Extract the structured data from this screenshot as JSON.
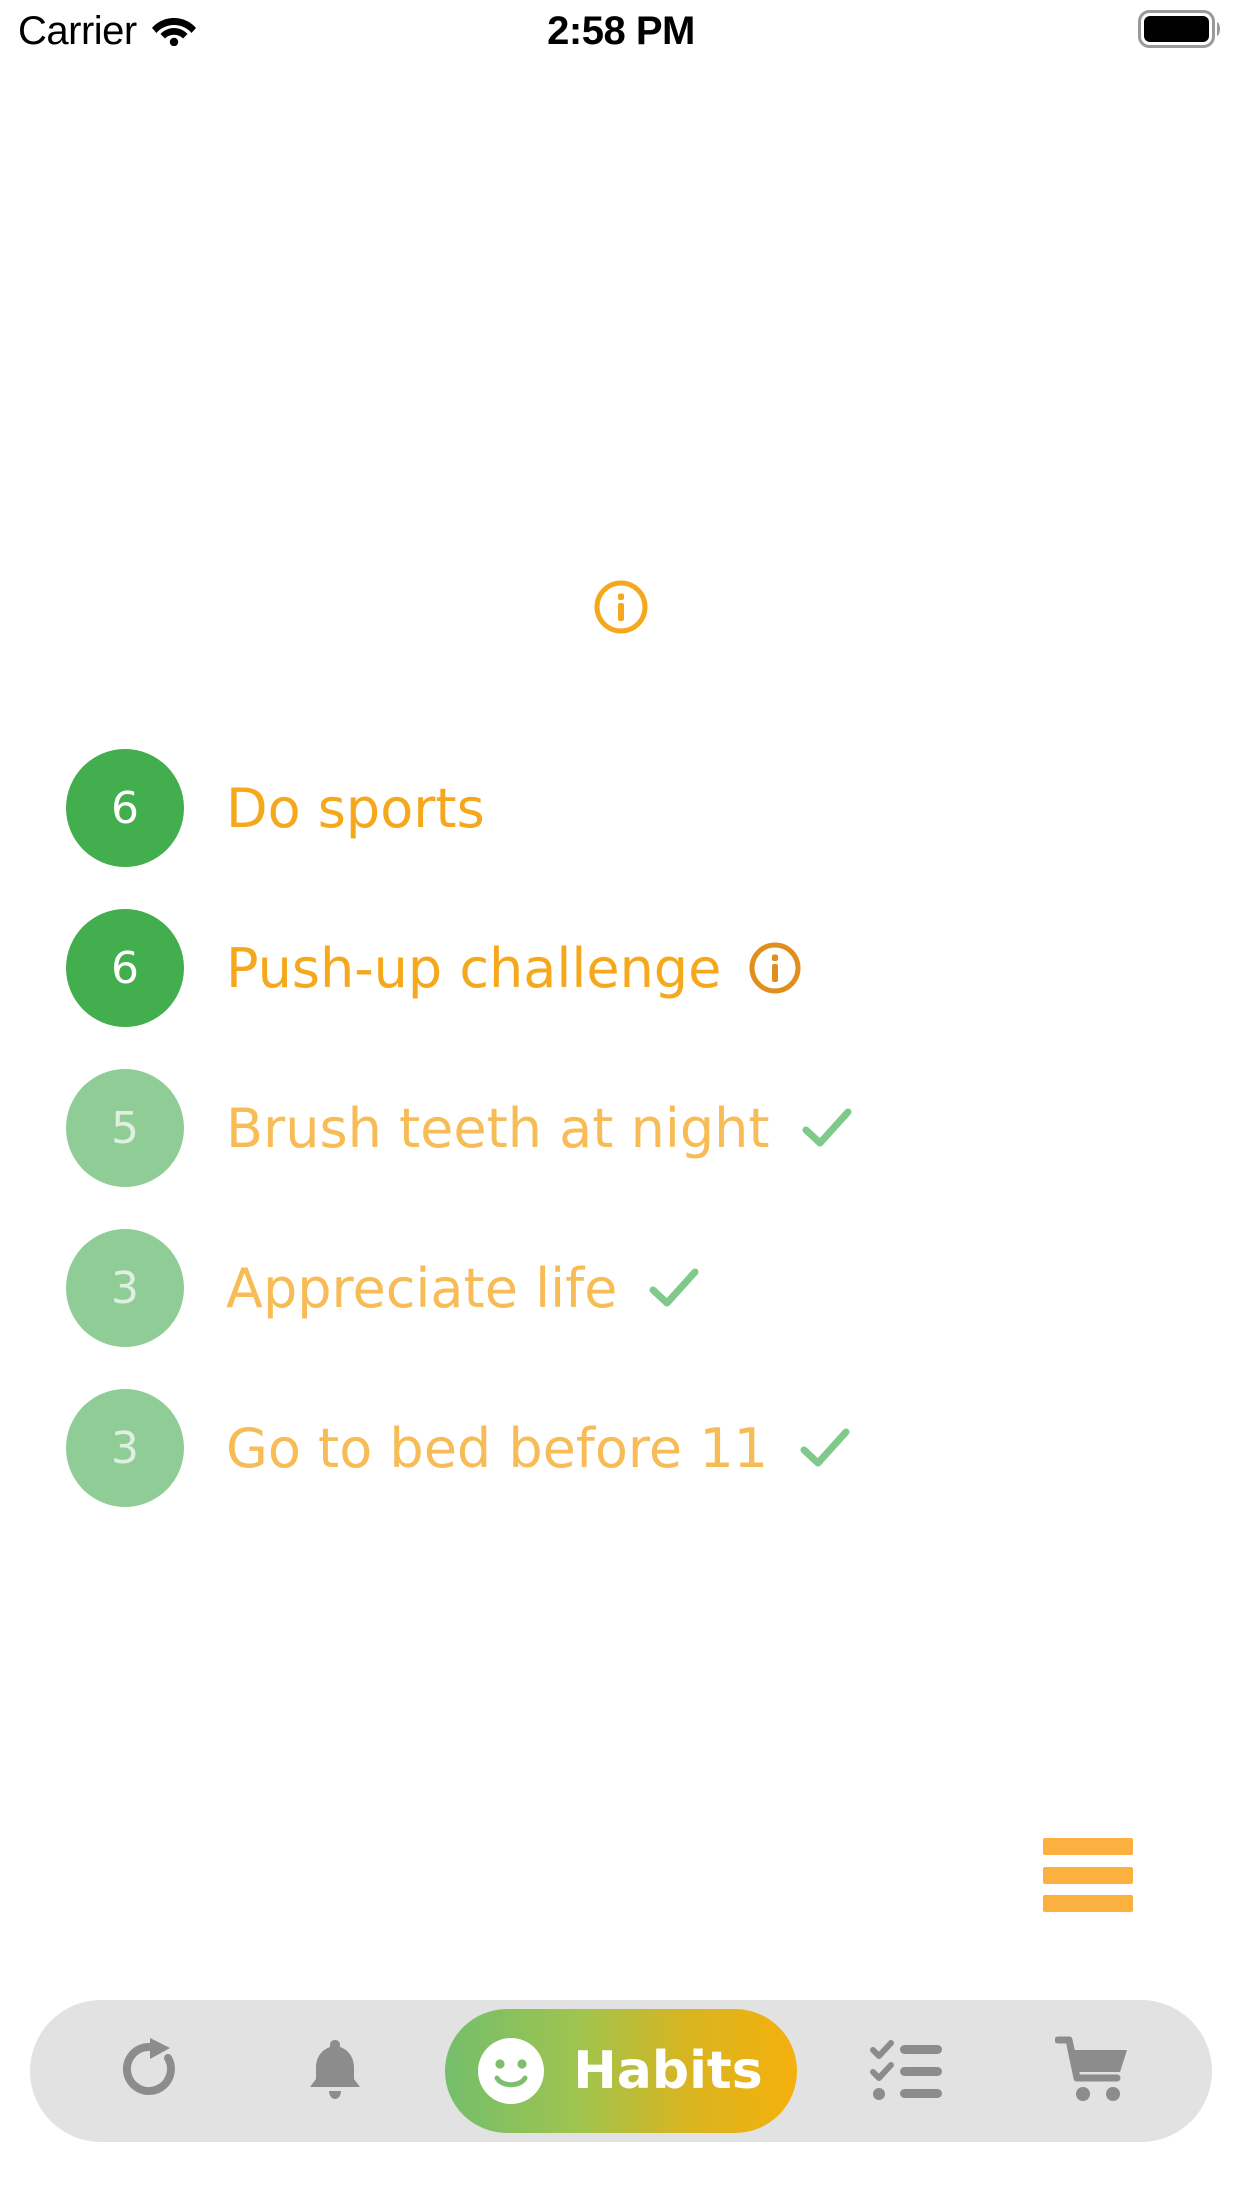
{
  "status_bar": {
    "carrier": "Carrier",
    "time": "2:58 PM",
    "wifi_icon": "wifi-icon",
    "battery_icon": "battery-full-icon"
  },
  "header": {
    "info_icon": "info-circle-icon",
    "info_icon_color": "#F5A81C"
  },
  "habits": {
    "items": [
      {
        "streak": "6",
        "label": "Do sports",
        "state": "active",
        "trailing": "none"
      },
      {
        "streak": "6",
        "label": "Push-up challenge",
        "state": "active",
        "trailing": "info"
      },
      {
        "streak": "5",
        "label": "Brush teeth at night",
        "state": "done",
        "trailing": "check"
      },
      {
        "streak": "3",
        "label": "Appreciate life",
        "state": "done",
        "trailing": "check"
      },
      {
        "streak": "3",
        "label": "Go to bed before 11",
        "state": "done",
        "trailing": "check"
      }
    ]
  },
  "menu_button": {
    "icon": "hamburger-menu-icon",
    "color": "#FCB040"
  },
  "tab_bar": {
    "background": "#e2e2e2",
    "icon_color": "#8c8c8c",
    "items": [
      {
        "icon": "refresh-icon",
        "label": ""
      },
      {
        "icon": "bell-icon",
        "label": ""
      },
      {
        "icon": "smiley-icon",
        "label": "Habits",
        "active": true
      },
      {
        "icon": "checklist-icon",
        "label": ""
      },
      {
        "icon": "shopping-cart-icon",
        "label": ""
      }
    ]
  },
  "colors": {
    "streak_active": "#42AE4E",
    "streak_done": "#90CD96",
    "label_active": "#F5A81C",
    "label_done": "#F7BC55",
    "check_green": "#7FC98A",
    "row_info_orange": "#E08E1E"
  }
}
